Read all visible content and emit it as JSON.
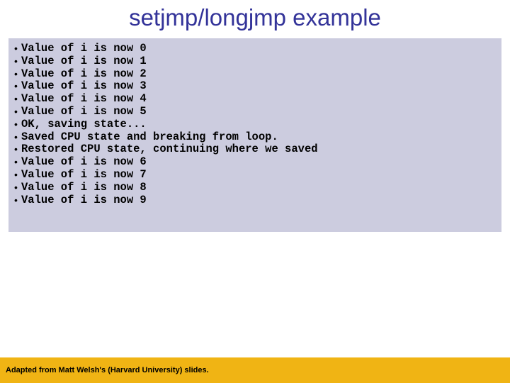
{
  "title": "setjmp/longjmp example",
  "lines": [
    {
      "text": "Value of i is now 0"
    },
    {
      "text": "Value of i is now 1"
    },
    {
      "text": "Value of i is now 2"
    },
    {
      "text": "Value of i is now 3"
    },
    {
      "text": "Value of i is now 4"
    },
    {
      "text": "Value of i is now 5"
    },
    {
      "text": "OK, saving state..."
    },
    {
      "text": "Saved CPU state and breaking from loop."
    },
    {
      "text": "Restored CPU state, continuing where we saved"
    },
    {
      "text": "Value of i is now 6"
    },
    {
      "text": "Value of i is now 7"
    },
    {
      "text": "Value of i is now 8"
    },
    {
      "text": "Value of i is now 9"
    }
  ],
  "footer": "Adapted from Matt Welsh's (Harvard University) slides."
}
